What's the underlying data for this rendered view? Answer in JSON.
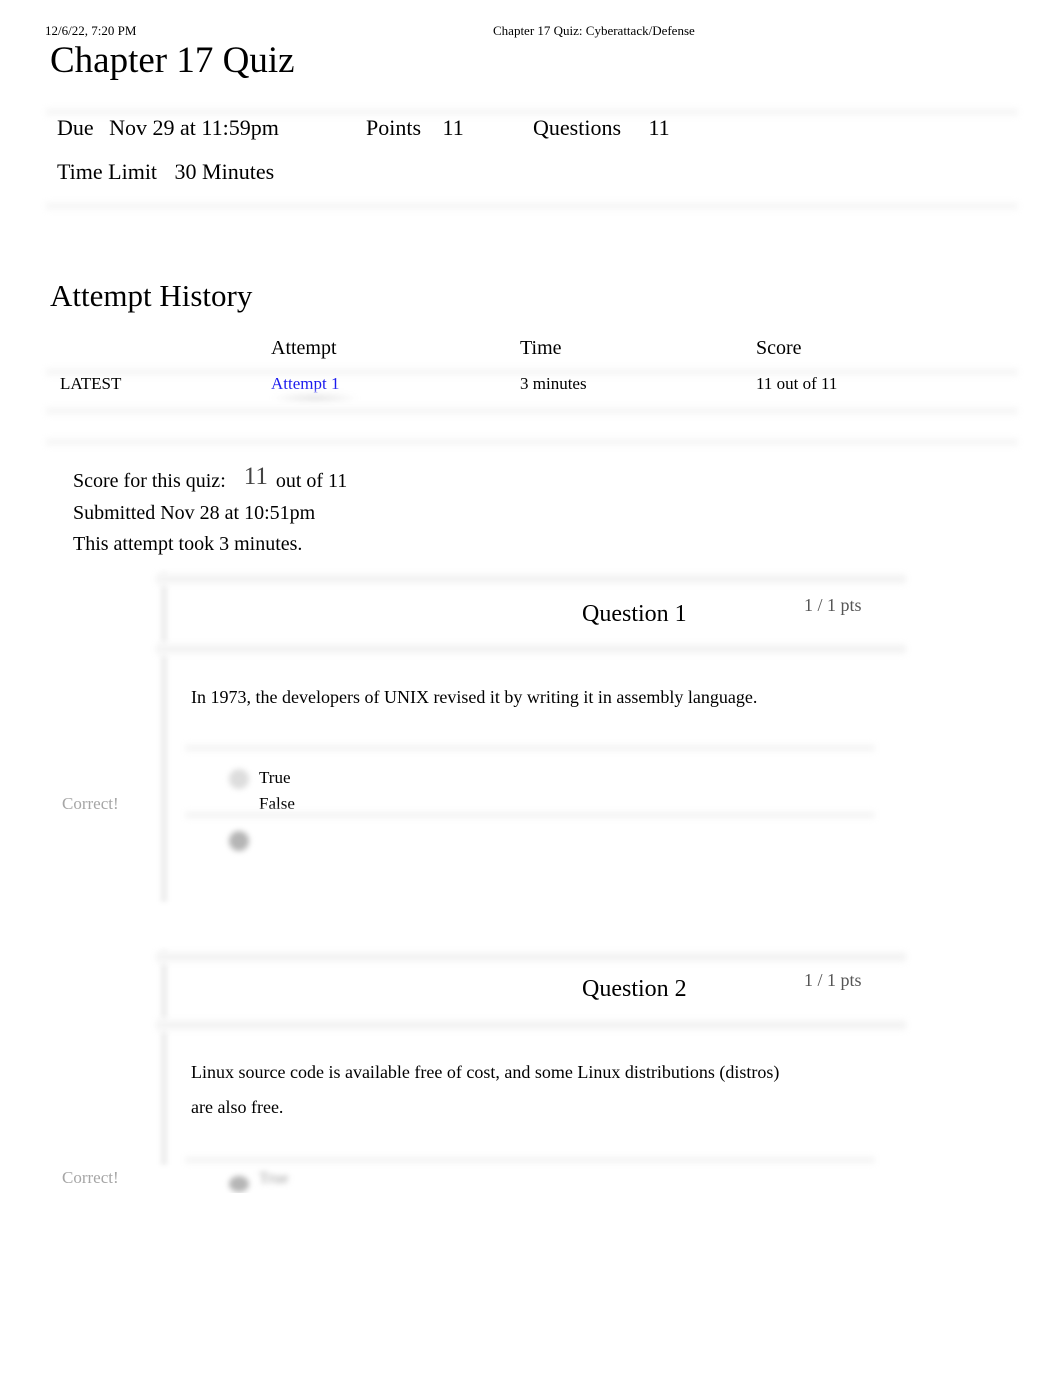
{
  "print_header": {
    "date": "12/6/22, 7:20 PM",
    "title": "Chapter 17 Quiz: Cyberattack/Defense"
  },
  "quiz": {
    "title": "Chapter 17 Quiz",
    "due_label": "Due",
    "due_value": "Nov 29 at 11:59pm",
    "points_label": "Points",
    "points_value": "11",
    "questions_label": "Questions",
    "questions_value": "11",
    "time_limit_label": "Time Limit",
    "time_limit_value": "30 Minutes"
  },
  "attempt_history": {
    "title": "Attempt History",
    "columns": [
      "",
      "Attempt",
      "Time",
      "Score"
    ],
    "rows": [
      {
        "tag": "LATEST",
        "attempt": "Attempt 1",
        "time": "3 minutes",
        "score": "11 out of 11"
      }
    ]
  },
  "result": {
    "score_label": "Score for this quiz:",
    "score_value": "11",
    "score_suffix": "out of 11",
    "submitted": "Submitted Nov 28 at 10:51pm",
    "duration": "This attempt took 3 minutes."
  },
  "questions": [
    {
      "title": "Question 1",
      "points": "1 / 1 pts",
      "text": "In 1973, the developers of UNIX revised it by writing it in assembly language.",
      "answers": [
        "True",
        "False"
      ],
      "selected": "False",
      "feedback": "Correct!"
    },
    {
      "title": "Question 2",
      "points": "1 / 1 pts",
      "text_line1": "Linux source code is available free of cost, and some Linux distributions (distros)",
      "text_line2": "are also free.",
      "answers": [
        "True"
      ],
      "selected": "True",
      "feedback": "Correct!"
    }
  ]
}
